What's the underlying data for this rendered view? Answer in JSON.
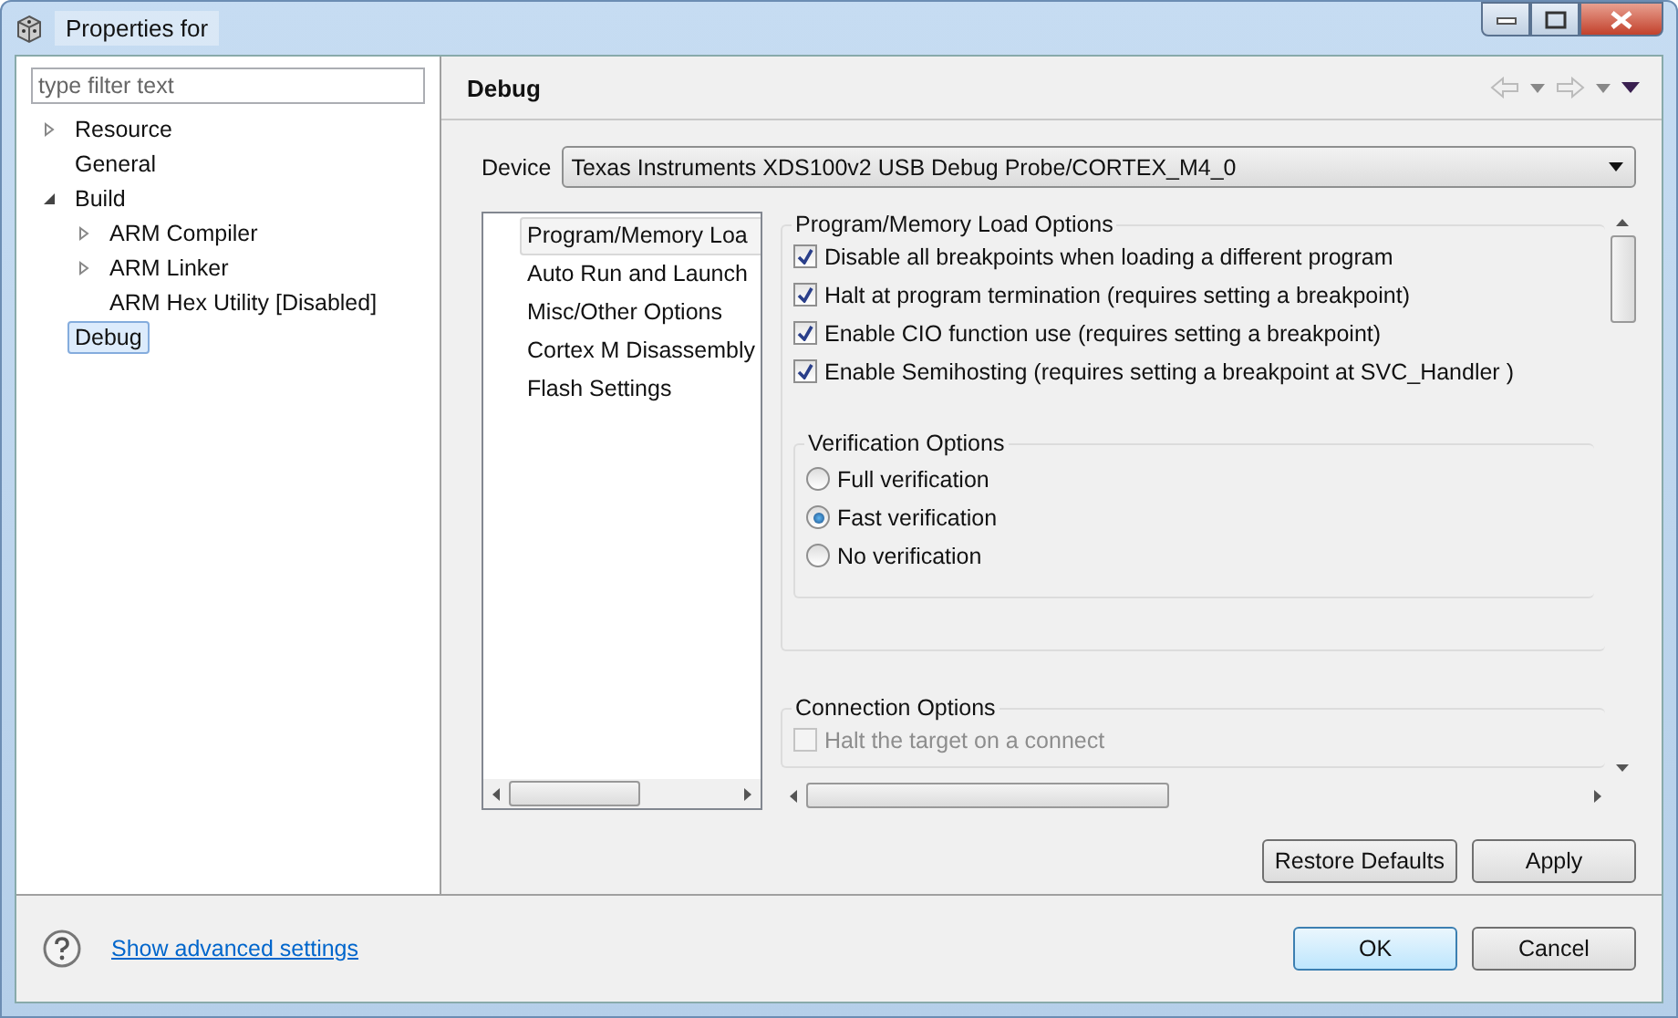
{
  "window": {
    "title": "Properties for"
  },
  "filter": {
    "placeholder": "type filter text"
  },
  "tree": [
    {
      "label": "Resource",
      "expanded": false,
      "selected": false
    },
    {
      "label": "General",
      "selected": false
    },
    {
      "label": "Build",
      "expanded": true,
      "selected": false,
      "children": [
        {
          "label": "ARM Compiler",
          "expanded": false,
          "selected": false
        },
        {
          "label": "ARM Linker",
          "expanded": false,
          "selected": false
        },
        {
          "label": "ARM Hex Utility  [Disabled]",
          "selected": false
        }
      ]
    },
    {
      "label": "Debug",
      "selected": true
    }
  ],
  "page": {
    "title": "Debug",
    "device_label": "Device",
    "device_value": "Texas Instruments XDS100v2 USB Debug Probe/CORTEX_M4_0"
  },
  "categories": [
    {
      "label": "Program/Memory Loa",
      "selected": true
    },
    {
      "label": "Auto Run and Launch",
      "selected": false
    },
    {
      "label": "Misc/Other Options",
      "selected": false
    },
    {
      "label": "Cortex M Disassembly",
      "selected": false
    },
    {
      "label": "Flash Settings",
      "selected": false
    }
  ],
  "load_options": {
    "title": "Program/Memory Load Options",
    "items": [
      {
        "label": "Disable all breakpoints when loading a different program",
        "checked": true
      },
      {
        "label": "Halt at program termination (requires setting a breakpoint)",
        "checked": true
      },
      {
        "label": "Enable CIO function use (requires setting a breakpoint)",
        "checked": true
      },
      {
        "label": "Enable Semihosting (requires setting a breakpoint at SVC_Handler )",
        "checked": true
      }
    ]
  },
  "verification": {
    "title": "Verification Options",
    "items": [
      {
        "label": "Full verification",
        "selected": false
      },
      {
        "label": "Fast verification",
        "selected": true
      },
      {
        "label": "No verification",
        "selected": false
      }
    ]
  },
  "connection": {
    "title": "Connection Options",
    "items": [
      {
        "label": "Halt the target on a connect",
        "checked": false,
        "disabled": true
      }
    ]
  },
  "page_buttons": [
    "Restore Defaults",
    "Apply"
  ],
  "footer": {
    "link": "Show advanced settings",
    "buttons": [
      {
        "label": "OK",
        "default": true
      },
      {
        "label": "Cancel",
        "default": false
      }
    ]
  }
}
